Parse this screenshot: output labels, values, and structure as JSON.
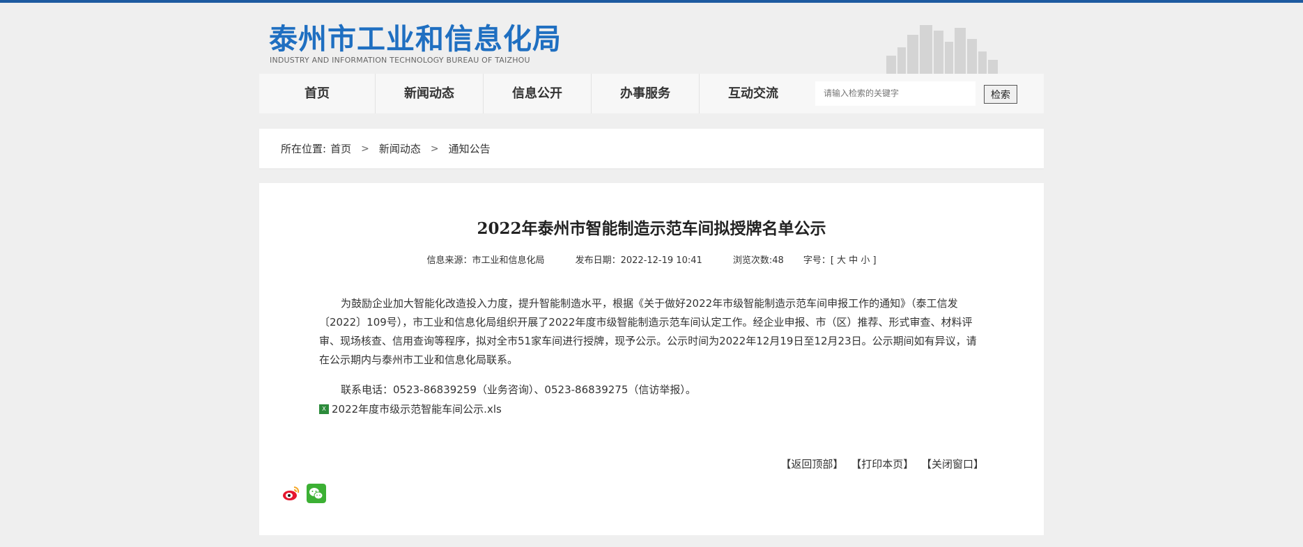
{
  "header": {
    "site_title_cn": "泰州市工业和信息化局",
    "site_title_en": "INDUSTRY AND INFORMATION TECHNOLOGY BUREAU OF TAIZHOU"
  },
  "nav": {
    "items": [
      "首页",
      "新闻动态",
      "信息公开",
      "办事服务",
      "互动交流"
    ],
    "search_placeholder": "请输入检索的关键字",
    "search_button": "检索"
  },
  "breadcrumb": {
    "label": "所在位置:",
    "items": [
      "首页",
      "新闻动态",
      "通知公告"
    ],
    "separator": ">"
  },
  "article": {
    "title": "2022年泰州市智能制造示范车间拟授牌名单公示",
    "meta": {
      "source": "信息来源：市工业和信息化局",
      "date": "发布日期：2022-12-19 10:41",
      "views": "浏览次数:48",
      "font_size": "字号：[ 大 中 小 ]"
    },
    "paragraphs": [
      "为鼓励企业加大智能化改造投入力度，提升智能制造水平，根据《关于做好2022年市级智能制造示范车间申报工作的通知》（泰工信发〔2022〕109号），市工业和信息化局组织开展了2022年度市级智能制造示范车间认定工作。经企业申报、市（区）推荐、形式审查、材料评审、现场核查、信用查询等程序，拟对全市51家车间进行授牌，现予公示。公示时间为2022年12月19日至12月23日。公示期间如有异议，请在公示期内与泰州市工业和信息化局联系。",
      "联系电话：0523-86839259（业务咨询）、0523-86839275（信访举报）。"
    ],
    "attachment": "2022年度市级示范智能车间公示.xls",
    "actions": [
      "【返回顶部】",
      "【打印本页】",
      "【关闭窗口】"
    ]
  },
  "colors": {
    "brand_blue": "#1f6fc1",
    "top_bar": "#1d5aa0",
    "page_bg": "#efefef",
    "weibo_red": "#e6162d",
    "wechat_green": "#3cb034"
  }
}
